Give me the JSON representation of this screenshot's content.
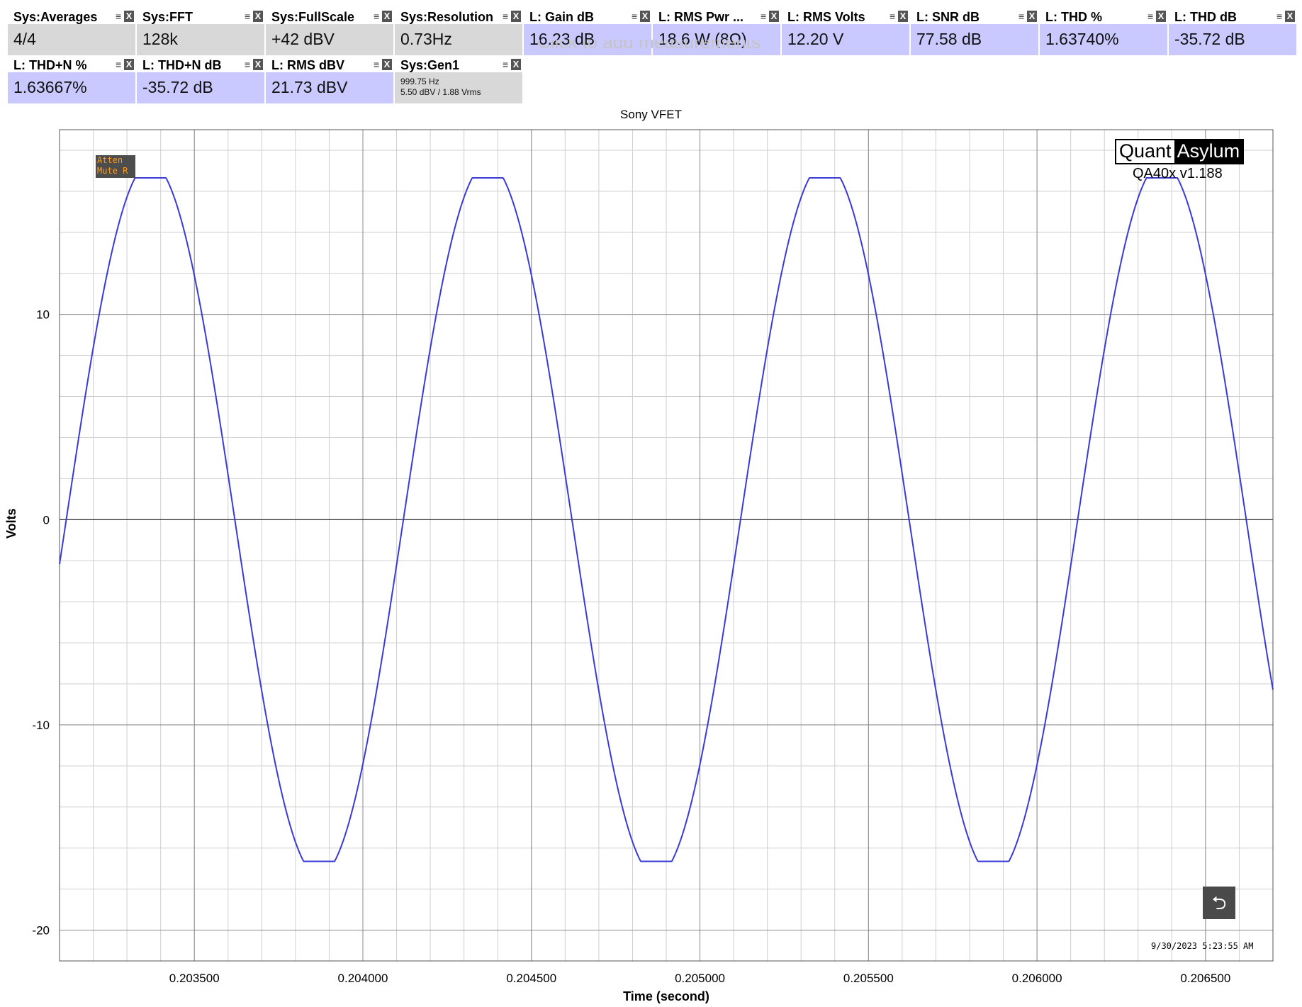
{
  "tiles": [
    {
      "label": "Sys:Averages",
      "value": "4/4",
      "kind": "sys"
    },
    {
      "label": "Sys:FFT",
      "value": "128k",
      "kind": "sys"
    },
    {
      "label": "Sys:FullScale",
      "value": "+42 dBV",
      "kind": "sys"
    },
    {
      "label": "Sys:Resolution",
      "value": "0.73Hz",
      "kind": "sys"
    },
    {
      "label": "L: Gain dB",
      "value": "16.23 dB",
      "kind": "meas"
    },
    {
      "label": "L: RMS Pwr ...",
      "value": "18.6 W (8Ω)",
      "kind": "meas"
    },
    {
      "label": "L: RMS Volts",
      "value": "12.20 V",
      "kind": "meas"
    },
    {
      "label": "L: SNR dB",
      "value": "77.58 dB",
      "kind": "meas"
    },
    {
      "label": "L: THD %",
      "value": "1.63740%",
      "kind": "meas"
    },
    {
      "label": "L: THD dB",
      "value": "-35.72 dB",
      "kind": "meas"
    },
    {
      "label": "L: THD+N %",
      "value": "1.63667%",
      "kind": "meas"
    },
    {
      "label": "L: THD+N dB",
      "value": "-35.72 dB",
      "kind": "meas"
    },
    {
      "label": "L: RMS dBV",
      "value": "21.73 dBV",
      "kind": "meas"
    }
  ],
  "gen_tile": {
    "label": "Sys:Gen1",
    "line1": "999.75 Hz",
    "line2": "5.50 dBV  / 1.88 Vrms"
  },
  "tile_icons": {
    "menu": "menu-icon",
    "close": "close-icon",
    "menu_glyph": "≡",
    "close_glyph": "X"
  },
  "ghost_text": "Click to add measurements",
  "badge": {
    "line1": "Atten",
    "line2": "Mute R"
  },
  "logo": {
    "part1": "Quant",
    "part2": "Asylum"
  },
  "version": "QA40x v1.188",
  "timestamp": "9/30/2023 5:23:55 AM",
  "back_button": {
    "icon": "undo-arrow-icon",
    "glyph": "⮌"
  },
  "colors": {
    "trace": "#3a3ad8",
    "sys_tile": "#d8d8d8",
    "meas_tile": "#c9c9ff",
    "badge_text": "#ff9b1e"
  },
  "chart_data": {
    "type": "line",
    "title": "Sony VFET",
    "xlabel": "Time (second)",
    "ylabel": "Volts",
    "xlim": [
      0.2031,
      0.2067
    ],
    "ylim": [
      -21.5,
      19
    ],
    "x_ticks": [
      {
        "value": 0.2035,
        "label": "0.203500"
      },
      {
        "value": 0.204,
        "label": "0.204000"
      },
      {
        "value": 0.2045,
        "label": "0.204500"
      },
      {
        "value": 0.205,
        "label": "0.205000"
      },
      {
        "value": 0.2055,
        "label": "0.205500"
      },
      {
        "value": 0.206,
        "label": "0.206000"
      },
      {
        "value": 0.2065,
        "label": "0.206500"
      }
    ],
    "y_ticks": [
      {
        "value": 10,
        "label": "10"
      },
      {
        "value": 0,
        "label": "0"
      },
      {
        "value": -10,
        "label": "-10"
      },
      {
        "value": -20,
        "label": "-20"
      }
    ],
    "grid": true,
    "series": [
      {
        "frequency_hz": 999.75,
        "amplitude": 16.7,
        "clip_level": 16.65,
        "peak_times": [
          0.20337,
          0.20437,
          0.20537,
          0.20637
        ]
      }
    ]
  }
}
